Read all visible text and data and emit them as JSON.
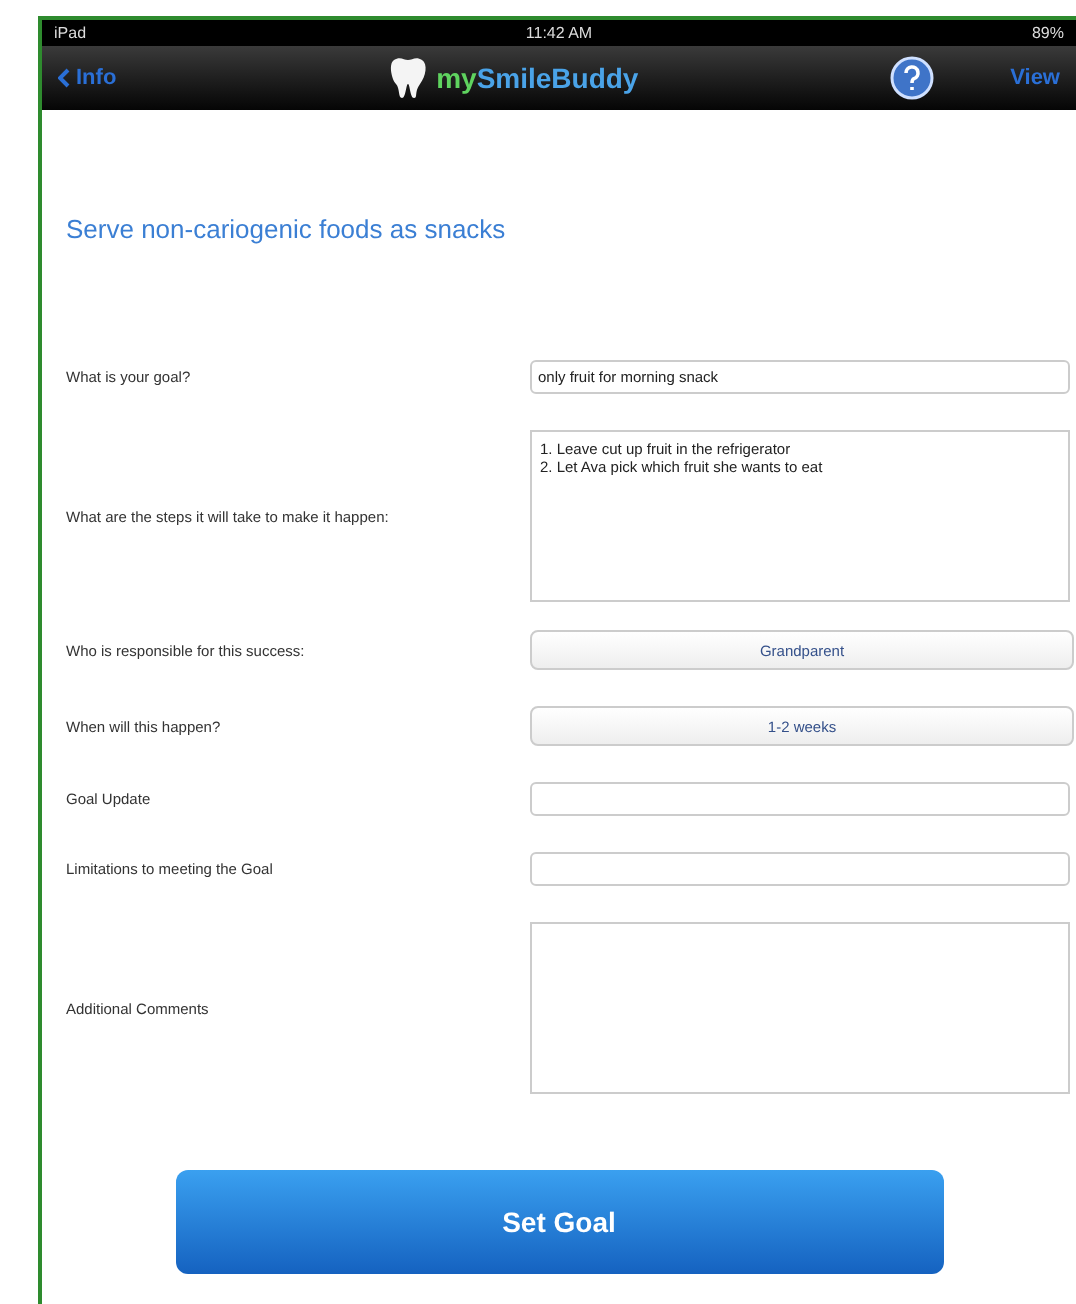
{
  "status_bar": {
    "carrier": "iPad",
    "time": "11:42 AM",
    "battery": "89%"
  },
  "nav_bar": {
    "back": "Info",
    "logo_prefix": "my",
    "logo_name": "SmileBuddy",
    "right": "View"
  },
  "heading": "Serve non-cariogenic foods as snacks",
  "fields": [
    {
      "label": "What is your goal?",
      "kind": "input",
      "value": "only fruit for morning snack"
    },
    {
      "label": "What are the steps it will take to make it happen:",
      "kind": "textarea",
      "value": "1. Leave cut up fruit in the refrigerator\n2. Let Ava pick which fruit she wants to eat"
    },
    {
      "label": "Who is responsible for this success:",
      "kind": "picker",
      "value": "Grandparent"
    },
    {
      "label": "When will this happen?",
      "kind": "picker",
      "value": "1-2 weeks"
    },
    {
      "label": "Goal Update",
      "kind": "input"
    },
    {
      "label": "Limitations to meeting the Goal",
      "kind": "input"
    },
    {
      "label": "Additional Comments",
      "kind": "textarea"
    }
  ],
  "submit": "Set Goal"
}
